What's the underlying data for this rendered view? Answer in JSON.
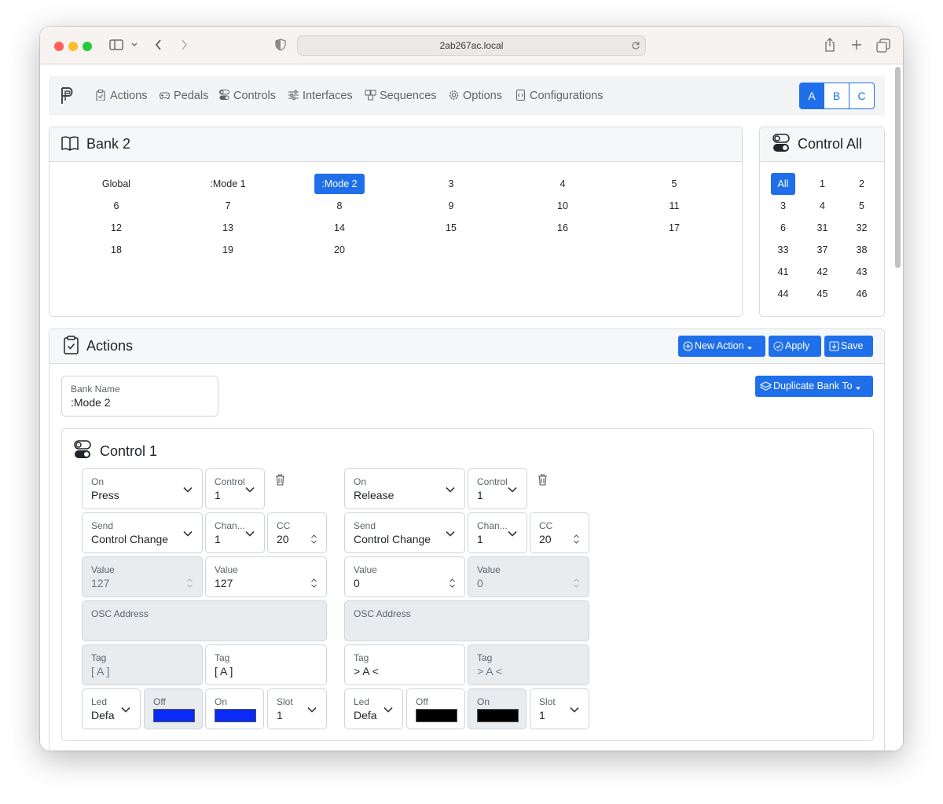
{
  "browser": {
    "url": "2ab267ac.local"
  },
  "nav": {
    "items": [
      {
        "label": "Actions",
        "icon": "clipboard-check-icon"
      },
      {
        "label": "Pedals",
        "icon": "gamepad-icon"
      },
      {
        "label": "Controls",
        "icon": "toggles-icon"
      },
      {
        "label": "Interfaces",
        "icon": "sliders-icon"
      },
      {
        "label": "Sequences",
        "icon": "boxes-icon"
      },
      {
        "label": "Options",
        "icon": "gear-icon"
      },
      {
        "label": "Configurations",
        "icon": "file-code-icon"
      }
    ],
    "profiles": [
      "A",
      "B",
      "C"
    ],
    "active_profile": "A"
  },
  "bank_panel": {
    "title": "Bank 2",
    "cells": [
      "Global",
      ":Mode 1",
      ":Mode 2",
      "3",
      "4",
      "5",
      "6",
      "7",
      "8",
      "9",
      "10",
      "11",
      "12",
      "13",
      "14",
      "15",
      "16",
      "17",
      "18",
      "19",
      "20"
    ],
    "active": ":Mode 2"
  },
  "control_panel": {
    "title": "Control All",
    "cells": [
      "All",
      "1",
      "2",
      "3",
      "4",
      "5",
      "6",
      "31",
      "32",
      "33",
      "37",
      "38",
      "41",
      "42",
      "43",
      "44",
      "45",
      "46"
    ],
    "active": "All"
  },
  "actions_panel": {
    "title": "Actions",
    "new_action": "New Action",
    "apply": "Apply",
    "save": "Save",
    "duplicate": "Duplicate Bank To",
    "bank_name_label": "Bank Name",
    "bank_name_value": ":Mode 2",
    "control_title": "Control 1",
    "groups": [
      {
        "on_label": "On",
        "on_value": "Press",
        "control_label": "Control",
        "control_value": "1",
        "send_label": "Send",
        "send_value": "Control Change",
        "channel_label": "Chan...",
        "channel_value": "1",
        "cc_label": "CC",
        "cc_value": "20",
        "value1_label": "Value",
        "value1_value": "127",
        "value2_label": "Value",
        "value2_value": "127",
        "osc_label": "OSC Address",
        "tag1_label": "Tag",
        "tag1_value": "[  A  ]",
        "tag2_label": "Tag",
        "tag2_value": "[  A  ]",
        "led_label": "Led",
        "led_value": "Defa",
        "off_label": "Off",
        "off_color": "#0a2bf5",
        "on2_label": "On",
        "on_color": "#0a2bf5",
        "slot_label": "Slot",
        "slot_value": "1"
      },
      {
        "on_label": "On",
        "on_value": "Release",
        "control_label": "Control",
        "control_value": "1",
        "send_label": "Send",
        "send_value": "Control Change",
        "channel_label": "Chan...",
        "channel_value": "1",
        "cc_label": "CC",
        "cc_value": "20",
        "value1_label": "Value",
        "value1_value": "0",
        "value2_label": "Value",
        "value2_value": "0",
        "osc_label": "OSC Address",
        "tag1_label": "Tag",
        "tag1_value": ">  A  <",
        "tag2_label": "Tag",
        "tag2_value": ">  A  <",
        "led_label": "Led",
        "led_value": "Defa",
        "off_label": "Off",
        "off_color": "#000000",
        "on2_label": "On",
        "on_color": "#000000",
        "slot_label": "Slot",
        "slot_value": "1"
      }
    ]
  },
  "colors": {
    "accent": "#1f6feb"
  }
}
